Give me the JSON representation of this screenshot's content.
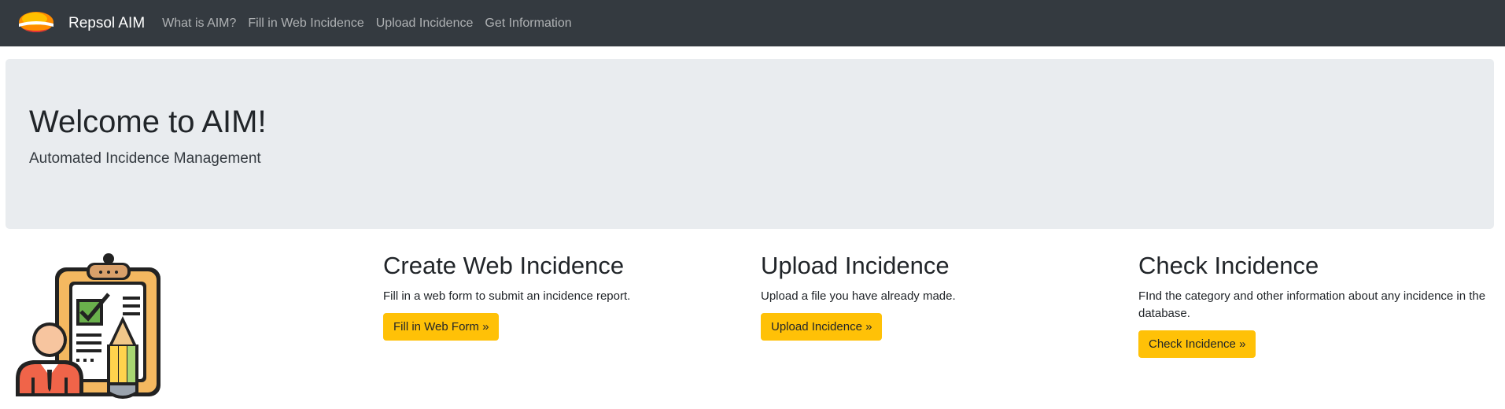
{
  "navbar": {
    "brand": "Repsol AIM",
    "links": [
      {
        "label": "What is AIM?"
      },
      {
        "label": "Fill in Web Incidence"
      },
      {
        "label": "Upload Incidence"
      },
      {
        "label": "Get Information"
      }
    ]
  },
  "jumbotron": {
    "title": "Welcome to AIM!",
    "subtitle": "Automated Incidence Management"
  },
  "cards": [
    {
      "title": "Create Web Incidence",
      "text": "Fill in a web form to submit an incidence report.",
      "button": "Fill in Web Form »"
    },
    {
      "title": "Upload Incidence",
      "text": "Upload a file you have already made.",
      "button": "Upload Incidence »"
    },
    {
      "title": "Check Incidence",
      "text": "FInd the category and other information about any incidence in the database.",
      "button": "Check Incidence »"
    }
  ],
  "colors": {
    "navbar": "#343a40",
    "accent": "#ffc107",
    "jumbotron": "#e9ecef"
  },
  "icons": {
    "brand": "repsol-logo-icon",
    "illustration": "checklist-person-icon"
  }
}
